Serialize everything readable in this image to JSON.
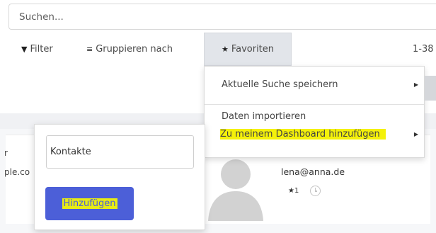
{
  "search": {
    "placeholder": "Suchen..."
  },
  "toolbar": {
    "filter_label": "Filter",
    "group_label": "Gruppieren nach",
    "favorites_label": "Favoriten",
    "pager_text": "1-38"
  },
  "favorites_menu": {
    "items": [
      {
        "label": "Aktuelle Suche speichern",
        "has_submenu": true
      },
      {
        "label": "Daten importieren",
        "has_submenu": false
      },
      {
        "label": "Zu meinem Dashboard hinzufügen",
        "has_submenu": true,
        "highlighted": true
      }
    ]
  },
  "dashboard_popover": {
    "input_value": "Kontakte",
    "add_button_label": "Hinzufügen"
  },
  "card": {
    "left_text_1": "r",
    "left_text_2": "ple.co",
    "email": "lena@anna.de",
    "star_count": "1"
  },
  "icons": {
    "filter": "filter-icon",
    "group": "list-icon",
    "favorites": "star-icon",
    "submenu": "caret-right-icon",
    "avatar": "person-silhouette-icon",
    "activity": "clock-icon"
  },
  "colors": {
    "primary_button": "#4c5fd8",
    "highlight": "#f4f10a",
    "favorites_active_bg": "#e2e5ea"
  }
}
